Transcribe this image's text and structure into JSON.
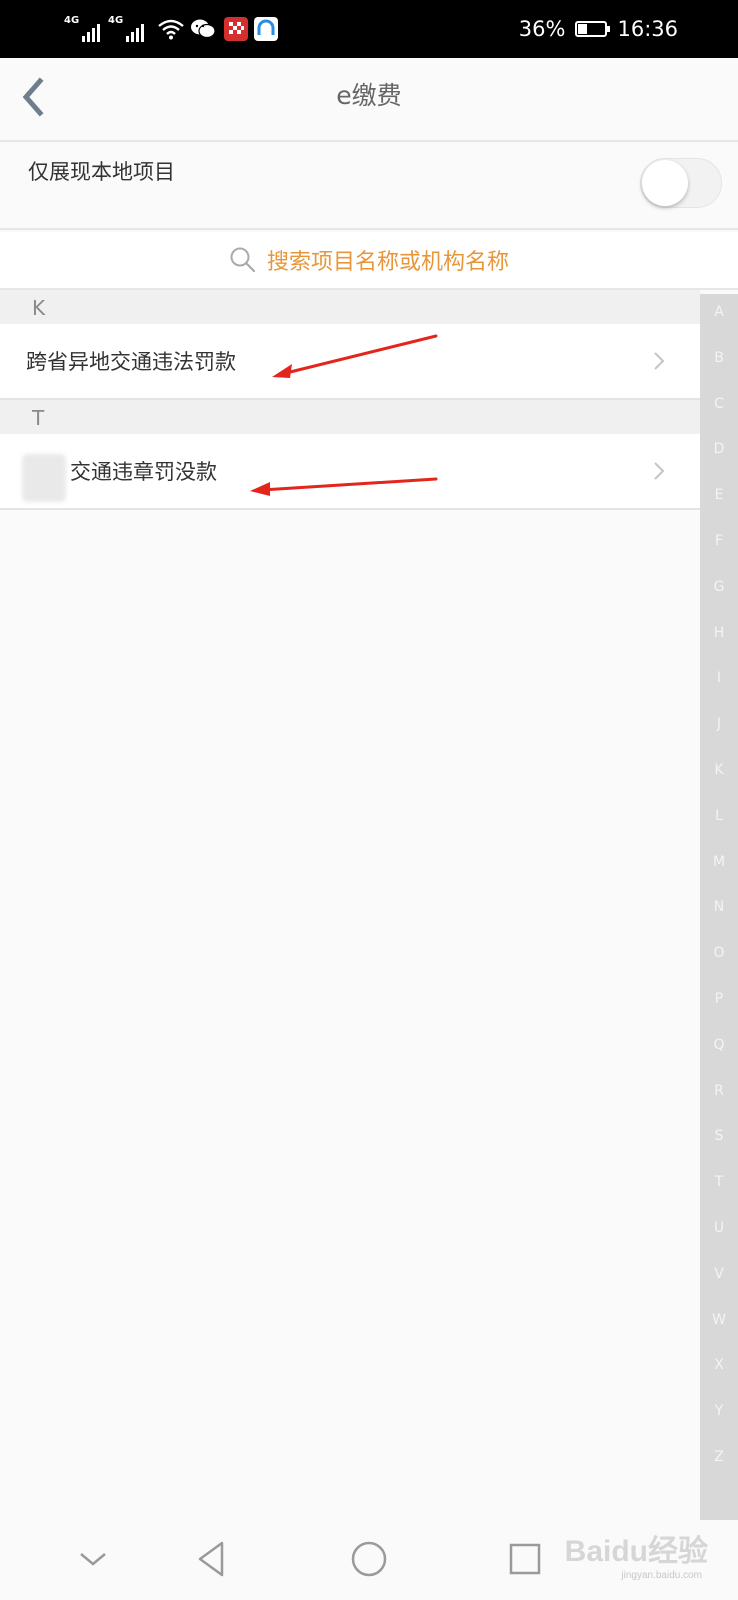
{
  "status_bar": {
    "network_1": "4G",
    "network_2": "4G",
    "battery_percent": "36%",
    "battery_level": 0.36,
    "time": "16:36",
    "icons": [
      "signal-icon",
      "signal-icon",
      "wifi-icon",
      "wechat-icon",
      "app-icon",
      "app-icon"
    ]
  },
  "header": {
    "title": "e缴费",
    "back_icon": "back-chevron-icon"
  },
  "local_filter": {
    "label": "仅展现本地项目",
    "toggle_on": false
  },
  "search": {
    "placeholder": "搜索项目名称或机构名称",
    "color": "#e8963a"
  },
  "sections": [
    {
      "letter": "K",
      "items": [
        {
          "label": "跨省异地交通违法罚款"
        }
      ]
    },
    {
      "letter": "T",
      "items": [
        {
          "label": "交通违章罚没款"
        }
      ]
    }
  ],
  "index_letters": [
    "A",
    "B",
    "C",
    "D",
    "E",
    "F",
    "G",
    "H",
    "I",
    "J",
    "K",
    "L",
    "M",
    "N",
    "O",
    "P",
    "Q",
    "R",
    "S",
    "T",
    "U",
    "V",
    "W",
    "X",
    "Y",
    "Z"
  ],
  "bottom_nav": {
    "icons": [
      "hide-keyboard-icon",
      "back-triangle-icon",
      "home-circle-icon",
      "recents-square-icon"
    ]
  },
  "watermark": {
    "main": "Baidu经验",
    "sub": "jingyan.baidu.com"
  },
  "annotation_color": "#e3261c"
}
